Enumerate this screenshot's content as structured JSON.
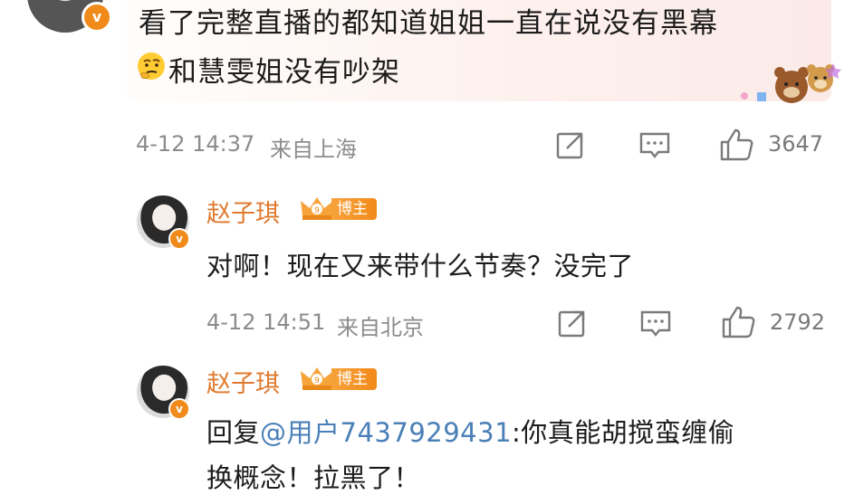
{
  "top_comment": {
    "text_line1": "看了完整直播的都知道姐姐一直在说没有黑幕",
    "text_line2": "和慧雯姐没有吵架",
    "time": "4-12 14:37",
    "location": "来自上海",
    "likes": "3647",
    "emoji_icon": "thinking-face-icon",
    "sticker": "bear-sticker"
  },
  "replies": [
    {
      "author": "赵子琪",
      "badge_label": "博主",
      "text": "对啊！现在又来带什么节奏？没完了",
      "time": "4-12 14:51",
      "location": "来自北京",
      "likes": "2792"
    },
    {
      "author": "赵子琪",
      "badge_label": "博主",
      "reply_prefix": "回复",
      "mention": "@用户7437929431",
      "text_after_mention": ":你真能胡搅蛮缠偷",
      "text_line2": "换概念！拉黑了！"
    }
  ],
  "colors": {
    "accent_orange": "#e07a2e",
    "mention_blue": "#4a7fb7",
    "meta_gray": "#8c8c8c"
  }
}
